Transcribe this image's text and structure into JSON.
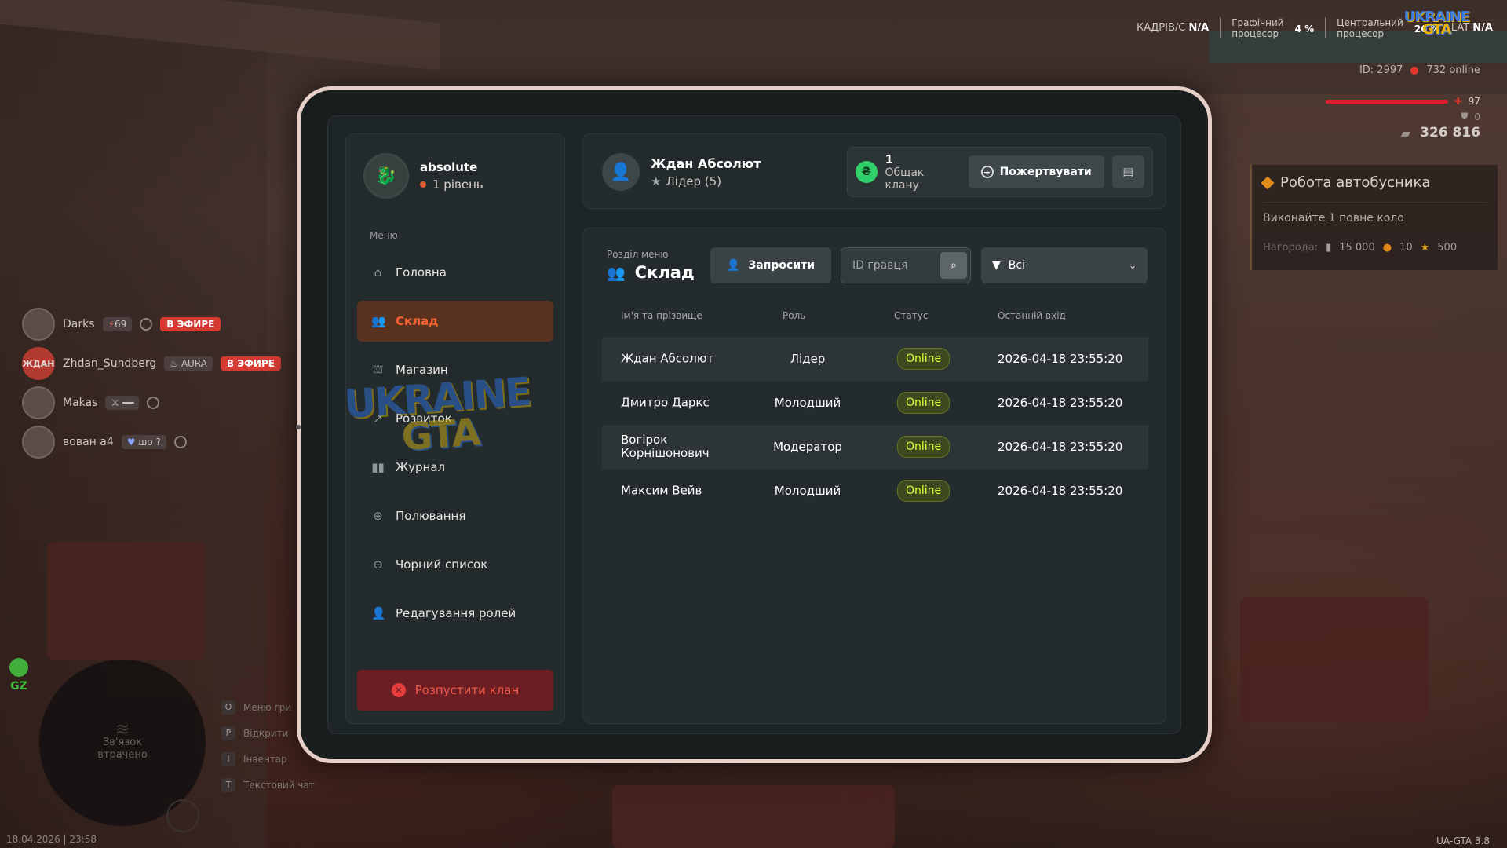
{
  "hud": {
    "fps_label": "КАДРІВ/С",
    "fps_value": "N/A",
    "gpu_label_1": "Графічний",
    "gpu_label_2": "процесор",
    "gpu_value": "4 %",
    "cpu_label_1": "Центральний",
    "cpu_label_2": "процесор",
    "cpu_value": "26 %",
    "lat_label": "LAT",
    "lat_value": "N/A",
    "logo": "UKRAINE",
    "logo_sub": "GTA",
    "player_id": "ID: 2997",
    "online": "732 online",
    "health": "97",
    "armor": "0",
    "money": "326 816"
  },
  "quest": {
    "title": "Робота автобусника",
    "description": "Виконайте 1 повне коло",
    "reward_label": "Нагорода:",
    "reward_money": "15 000",
    "reward_coins": "10",
    "reward_stars": "500"
  },
  "players": [
    {
      "name": "Darks",
      "tag": "69",
      "air": "В ЭФИРЕ",
      "avatar": ""
    },
    {
      "name": "Zhdan_Sundberg",
      "tag": "AURA",
      "air": "В ЭФИРЕ",
      "avatar": "ЖДАН"
    },
    {
      "name": "Makas",
      "tag": "",
      "air": "",
      "avatar": ""
    },
    {
      "name": "вован а4",
      "tag": "шо ?",
      "air": "",
      "avatar": ""
    }
  ],
  "minimap": {
    "gz": "GZ",
    "lost_1": "Зв'язок",
    "lost_2": "втрачено"
  },
  "hotkeys": [
    {
      "key": "O",
      "label": "Меню гри"
    },
    {
      "key": "P",
      "label": "Відкрити"
    },
    {
      "key": "I",
      "label": "Інвентар"
    },
    {
      "key": "T",
      "label": "Текстовий чат"
    }
  ],
  "timestamp": "18.04.2026 | 23:58",
  "version": "UA-GTA 3.8",
  "profile": {
    "name": "absolute",
    "level": "1 рівень"
  },
  "menu": {
    "caption": "Меню",
    "items": [
      {
        "label": "Головна",
        "icon": "home-icon"
      },
      {
        "label": "Склад",
        "icon": "people-icon"
      },
      {
        "label": "Магазин",
        "icon": "basket-icon"
      },
      {
        "label": "Розвиток",
        "icon": "chart-icon"
      },
      {
        "label": "Журнал",
        "icon": "book-icon"
      },
      {
        "label": "Полювання",
        "icon": "crosshair-icon"
      },
      {
        "label": "Чорний список",
        "icon": "block-icon"
      },
      {
        "label": "Редагування ролей",
        "icon": "user-edit-icon"
      }
    ],
    "disband": "Розпустити клан"
  },
  "leader": {
    "name": "Ждан Абсолют",
    "role": "Лідер (5)"
  },
  "bank": {
    "coin": "₴",
    "amount": "1",
    "caption": "Общак клану",
    "donate": "Пожертвувати"
  },
  "section": {
    "caption": "Розділ меню",
    "title": "Склад",
    "invite": "Запросити",
    "search_placeholder": "ID гравця",
    "filter": "Всі"
  },
  "table": {
    "headers": [
      "Ім'я та прізвище",
      "Роль",
      "Статус",
      "Останній вхід"
    ],
    "rows": [
      {
        "name": "Ждан Абсолют",
        "role": "Лідер",
        "status": "Online",
        "last": "2026-04-18 23:55:20"
      },
      {
        "name": "Дмитро Даркс",
        "role": "Молодший",
        "status": "Online",
        "last": "2026-04-18 23:55:20"
      },
      {
        "name": "Вогірок Корнішонович",
        "role": "Модератор",
        "status": "Online",
        "last": "2026-04-18 23:55:20"
      },
      {
        "name": "Максим Вейв",
        "role": "Молодший",
        "status": "Online",
        "last": "2026-04-18 23:55:20"
      }
    ]
  },
  "watermark": {
    "line1": "UKRAINE",
    "line2": "GTA"
  },
  "colors": {
    "accent": "#f3612f",
    "online": "#d8ff3a",
    "danger": "#e83d3d"
  }
}
